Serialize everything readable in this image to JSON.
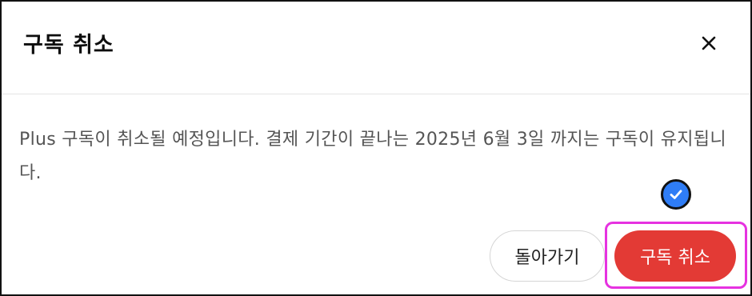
{
  "dialog": {
    "title": "구독 취소",
    "message": "Plus 구독이 취소될 예정입니다. 결제 기간이 끝나는 2025년 6월 3일 까지는 구독이 유지됩니다.",
    "close_icon": "close-icon",
    "check_icon": "check-circle-icon",
    "back_label": "돌아가기",
    "confirm_label": "구독 취소"
  },
  "colors": {
    "confirm_button": "#e33a35",
    "check_badge": "#2f7df6",
    "highlight": "#e632e0"
  }
}
